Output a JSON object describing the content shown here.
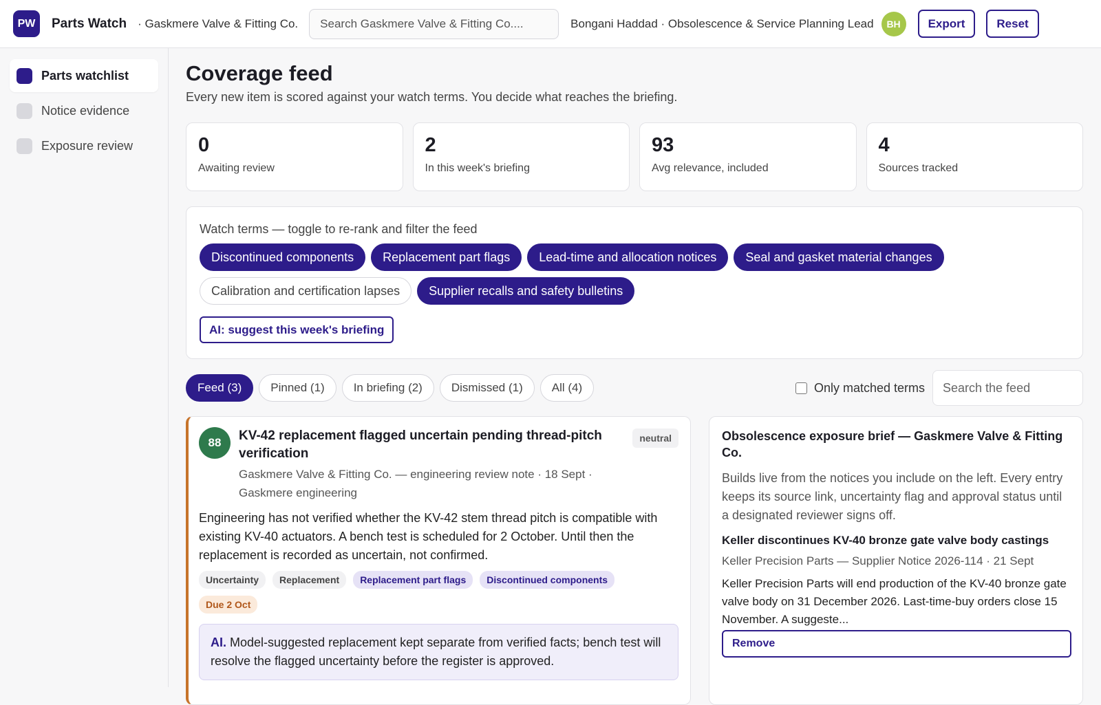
{
  "header": {
    "logo": "PW",
    "app_name": "Parts Watch",
    "org": "· Gaskmere Valve & Fitting Co.",
    "search_placeholder": "Search Gaskmere Valve & Fitting Co....",
    "user": "Bongani Haddad · Obsolescence & Service Planning Lead",
    "avatar": "BH",
    "export_label": "Export",
    "reset_label": "Reset"
  },
  "sidebar": {
    "items": [
      {
        "label": "Parts watchlist",
        "active": true
      },
      {
        "label": "Notice evidence",
        "active": false
      },
      {
        "label": "Exposure review",
        "active": false
      }
    ]
  },
  "main": {
    "title": "Coverage feed",
    "subtitle": "Every new item is scored against your watch terms. You decide what reaches the briefing.",
    "stats": [
      {
        "value": "0",
        "label": "Awaiting review"
      },
      {
        "value": "2",
        "label": "In this week's briefing"
      },
      {
        "value": "93",
        "label": "Avg relevance, included"
      },
      {
        "value": "4",
        "label": "Sources tracked"
      }
    ],
    "watch_terms": {
      "label": "Watch terms — toggle to re-rank and filter the feed",
      "chips": [
        {
          "label": "Discontinued components",
          "on": true
        },
        {
          "label": "Replacement part flags",
          "on": true
        },
        {
          "label": "Lead-time and allocation notices",
          "on": true
        },
        {
          "label": "Seal and gasket material changes",
          "on": true
        },
        {
          "label": "Calibration and certification lapses",
          "on": false
        },
        {
          "label": "Supplier recalls and safety bulletins",
          "on": true
        }
      ],
      "ai_button": "AI: suggest this week's briefing"
    },
    "tabs": [
      {
        "label": "Feed (3)",
        "active": true
      },
      {
        "label": "Pinned (1)",
        "active": false
      },
      {
        "label": "In briefing (2)",
        "active": false
      },
      {
        "label": "Dismissed (1)",
        "active": false
      },
      {
        "label": "All (4)",
        "active": false
      }
    ],
    "only_matched_label": "Only matched terms",
    "feed_search_placeholder": "Search the feed"
  },
  "feed_card": {
    "score": "88",
    "title": "KV-42 replacement flagged uncertain pending thread-pitch verification",
    "meta": "Gaskmere Valve & Fitting Co. — engineering review note · 18 Sept · Gaskmere engineering",
    "sentiment": "neutral",
    "body": "Engineering has not verified whether the KV-42 stem thread pitch is compatible with existing KV-40 actuators. A bench test is scheduled for 2 October. Until then the replacement is recorded as uncertain, not confirmed.",
    "tags": [
      {
        "label": "Uncertainty",
        "kind": "plain"
      },
      {
        "label": "Replacement",
        "kind": "plain"
      },
      {
        "label": "Replacement part flags",
        "kind": "match"
      },
      {
        "label": "Discontinued components",
        "kind": "match"
      },
      {
        "label": "Due 2 Oct",
        "kind": "due"
      }
    ],
    "ai_label": "AI.",
    "ai_note": "Model-suggested replacement kept separate from verified facts; bench test will resolve the flagged uncertainty before the register is approved."
  },
  "brief": {
    "title": "Obsolescence exposure brief — Gaskmere Valve & Fitting Co.",
    "description": "Builds live from the notices you include on the left. Every entry keeps its source link, uncertainty flag and approval status until a designated reviewer signs off.",
    "entry": {
      "title": "Keller discontinues KV-40 bronze gate valve body castings",
      "meta": "Keller Precision Parts — Supplier Notice 2026-114 · 21 Sept",
      "body": "Keller Precision Parts will end production of the KV-40 bronze gate valve body on 31 December 2026. Last-time-buy orders close 15 November. A suggeste...",
      "remove_label": "Remove"
    }
  },
  "colors": {
    "accent": "#2d1c8a",
    "score_green": "#2e7a4c",
    "card_border": "#c7742b",
    "avatar": "#a6c74a"
  }
}
